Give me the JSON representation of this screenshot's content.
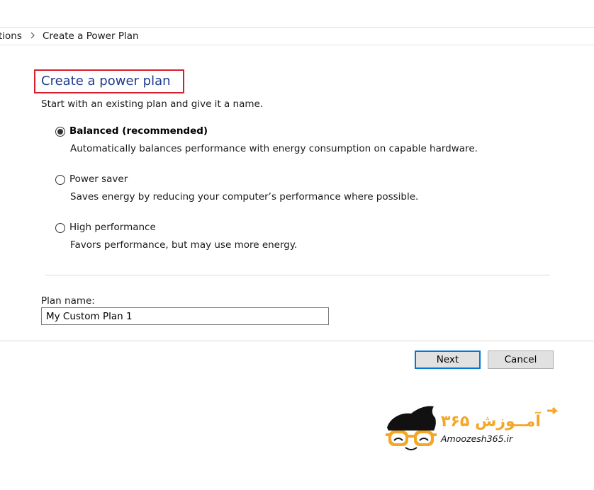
{
  "breadcrumb": {
    "partial": "tions",
    "current": "Create a Power Plan"
  },
  "page": {
    "title": "Create a power plan",
    "intro": "Start with an existing plan and give it a name."
  },
  "options": [
    {
      "label": "Balanced (recommended)",
      "description": "Automatically balances performance with energy consumption on capable hardware.",
      "checked": true
    },
    {
      "label": "Power saver",
      "description": "Saves energy by reducing your computer’s performance where possible.",
      "checked": false
    },
    {
      "label": "High performance",
      "description": "Favors performance, but may use more energy.",
      "checked": false
    }
  ],
  "plan_name": {
    "label": "Plan name:",
    "value": "My Custom Plan 1"
  },
  "buttons": {
    "next": "Next",
    "cancel": "Cancel"
  },
  "watermark": {
    "brand_text": "آمــوزش ۳۶۵",
    "url": "Amoozesh365.ir"
  },
  "colors": {
    "title_blue": "#1e3a8c",
    "highlight_red": "#d71f2c",
    "focus_blue": "#0078d7",
    "logo_orange": "#f5a623"
  }
}
